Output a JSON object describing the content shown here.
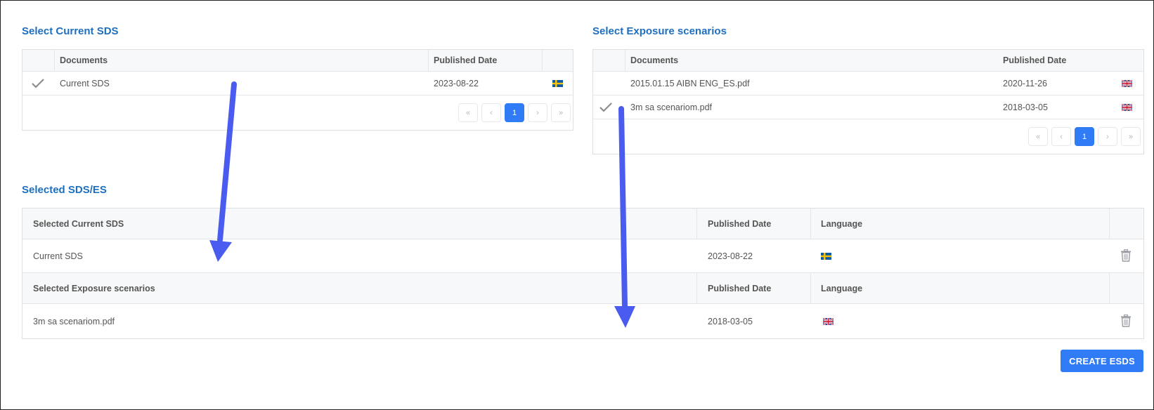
{
  "current_sds": {
    "title": "Select Current SDS",
    "headers": {
      "documents": "Documents",
      "published": "Published Date"
    },
    "rows": [
      {
        "name": "Current SDS",
        "date": "2023-08-22",
        "flag": "sweden-flag-icon",
        "checked": true
      }
    ],
    "pager": {
      "first": "«",
      "prev": "‹",
      "page": "1",
      "next": "›",
      "last": "»"
    }
  },
  "exposure": {
    "title": "Select Exposure scenarios",
    "headers": {
      "documents": "Documents",
      "published": "Published Date"
    },
    "rows": [
      {
        "name": "2015.01.15 AIBN ENG_ES.pdf",
        "date": "2020-11-26",
        "flag": "uk-flag-icon",
        "checked": false
      },
      {
        "name": "3m sa scenariom.pdf",
        "date": "2018-03-05",
        "flag": "uk-flag-icon",
        "checked": true
      }
    ],
    "pager": {
      "first": "«",
      "prev": "‹",
      "page": "1",
      "next": "›",
      "last": "»"
    }
  },
  "selected": {
    "title": "Selected SDS/ES",
    "sds_header": {
      "name": "Selected Current SDS",
      "published": "Published Date",
      "language": "Language"
    },
    "sds_row": {
      "name": "Current SDS",
      "date": "2023-08-22",
      "flag": "sweden-flag-icon"
    },
    "es_header": {
      "name": "Selected Exposure scenarios",
      "published": "Published Date",
      "language": "Language"
    },
    "es_row": {
      "name": "3m sa scenariom.pdf",
      "date": "2018-03-05",
      "flag": "uk-flag-icon"
    }
  },
  "create_button": "CREATE ESDS",
  "colors": {
    "accent": "#2f7cf6",
    "title": "#1f6fbf",
    "annotation_arrow": "#4a5cf0"
  }
}
